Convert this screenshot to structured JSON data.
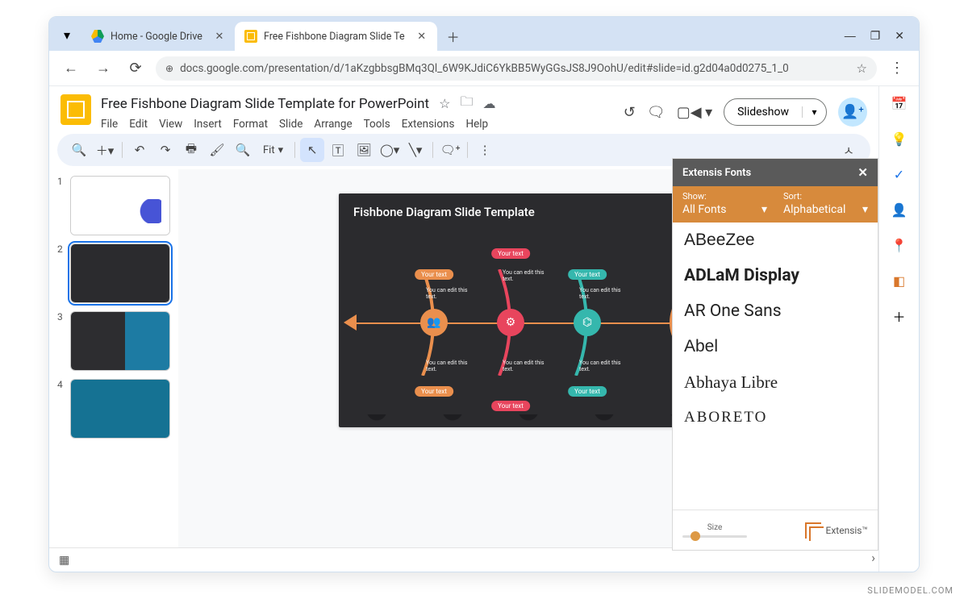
{
  "browser": {
    "tabs": [
      {
        "label": "Home - Google Drive",
        "active": false
      },
      {
        "label": "Free Fishbone Diagram Slide Te",
        "active": true
      }
    ],
    "url": "docs.google.com/presentation/d/1aKzgbbsgBMq3Ql_6W9KJdiC6YkBB5WyGGsJS8J9OohU/edit#slide=id.g2d04a0d0275_1_0"
  },
  "doc": {
    "title": "Free Fishbone Diagram Slide Template for PowerPoint",
    "menus": [
      "File",
      "Edit",
      "View",
      "Insert",
      "Format",
      "Slide",
      "Arrange",
      "Tools",
      "Extensions",
      "Help"
    ],
    "slideshow_label": "Slideshow",
    "zoom_label": "Fit"
  },
  "slide": {
    "title": "Fishbone Diagram Slide Template",
    "page_number": "2",
    "bones": [
      {
        "color": "#ea8f4d",
        "pill_top": "Your text",
        "pill_bottom": "Your text",
        "hint": "You can edit this text."
      },
      {
        "color": "#e8455d",
        "pill_top": "Your text",
        "pill_bottom": "Your text",
        "hint": "You can edit this text."
      },
      {
        "color": "#35b7ad",
        "pill_top": "Your text",
        "pill_bottom": "Your text",
        "hint": "You can edit this text."
      }
    ]
  },
  "thumbnails": [
    "1",
    "2",
    "3",
    "4"
  ],
  "ext": {
    "title": "Extensis Fonts",
    "show_label": "Show:",
    "show_value": "All Fonts",
    "sort_label": "Sort:",
    "sort_value": "Alphabetical",
    "fonts": [
      "ABeeZee",
      "ADLaM Display",
      "AR One Sans",
      "Abel",
      "Abhaya Libre",
      "ABORETO"
    ],
    "size_label": "Size",
    "brand": "Extensis™"
  },
  "watermark": "SLIDEMODEL.COM"
}
